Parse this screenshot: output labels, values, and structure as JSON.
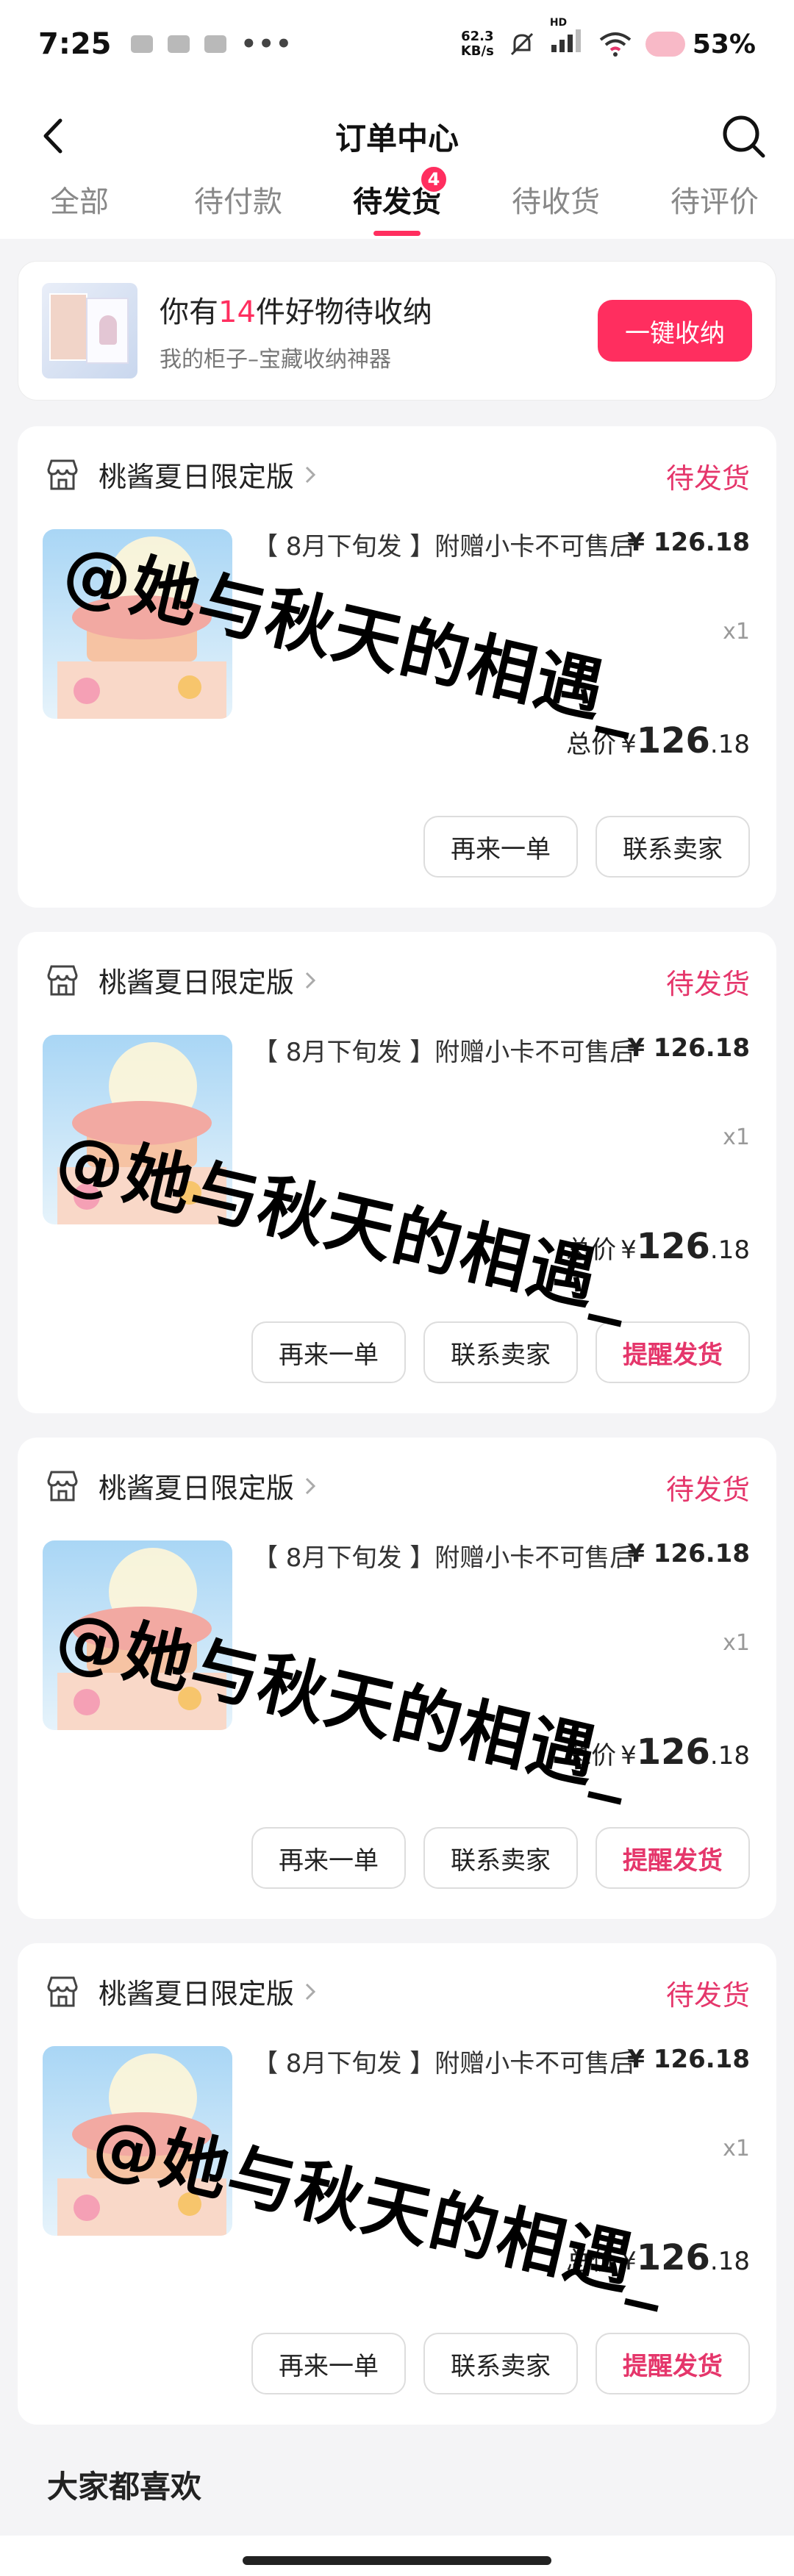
{
  "status_bar": {
    "time": "7:25",
    "dots": "•••",
    "speed_value": "62.3",
    "speed_unit": "KB/s",
    "hd": "HD",
    "battery": "53%"
  },
  "nav": {
    "title": "订单中心",
    "back_icon": "back-chevron-icon",
    "search_icon": "search-icon"
  },
  "tabs": [
    {
      "label": "全部"
    },
    {
      "label": "待付款"
    },
    {
      "label": "待发货",
      "badge": "4",
      "active": true
    },
    {
      "label": "待收货"
    },
    {
      "label": "待评价"
    }
  ],
  "promo": {
    "title_prefix": "你有",
    "count": "14",
    "title_suffix": "件好物待收纳",
    "subtitle": "我的柜子–宝藏收纳神器",
    "button": "一键收纳"
  },
  "orders": [
    {
      "shop": "桃酱夏日限定版",
      "status": "待发货",
      "title": "【 8月下旬发 】附赠小卡不可售后",
      "price": "¥ 126.18",
      "qty": "x1",
      "total_label": "总价",
      "total_symbol": "¥",
      "total_int": "126",
      "total_dec": ".18",
      "buttons": [
        "再来一单",
        "联系卖家"
      ]
    },
    {
      "shop": "桃酱夏日限定版",
      "status": "待发货",
      "title": "【 8月下旬发 】附赠小卡不可售后",
      "price": "¥ 126.18",
      "qty": "x1",
      "total_label": "总价",
      "total_symbol": "¥",
      "total_int": "126",
      "total_dec": ".18",
      "buttons": [
        "再来一单",
        "联系卖家",
        "提醒发货"
      ]
    },
    {
      "shop": "桃酱夏日限定版",
      "status": "待发货",
      "title": "【 8月下旬发 】附赠小卡不可售后",
      "price": "¥ 126.18",
      "qty": "x1",
      "total_label": "总价",
      "total_symbol": "¥",
      "total_int": "126",
      "total_dec": ".18",
      "buttons": [
        "再来一单",
        "联系卖家",
        "提醒发货"
      ]
    },
    {
      "shop": "桃酱夏日限定版",
      "status": "待发货",
      "title": "【 8月下旬发 】附赠小卡不可售后",
      "price": "¥ 126.18",
      "qty": "x1",
      "total_label": "总价",
      "total_symbol": "¥",
      "total_int": "126",
      "total_dec": ".18",
      "buttons": [
        "再来一单",
        "联系卖家",
        "提醒发货"
      ]
    }
  ],
  "watermark": "@她与秋天的相遇_",
  "recommend_title": "大家都喜欢",
  "colors": {
    "accent": "#ff2e5f",
    "status_pink": "#e5366b",
    "background": "#f4f4f6"
  }
}
